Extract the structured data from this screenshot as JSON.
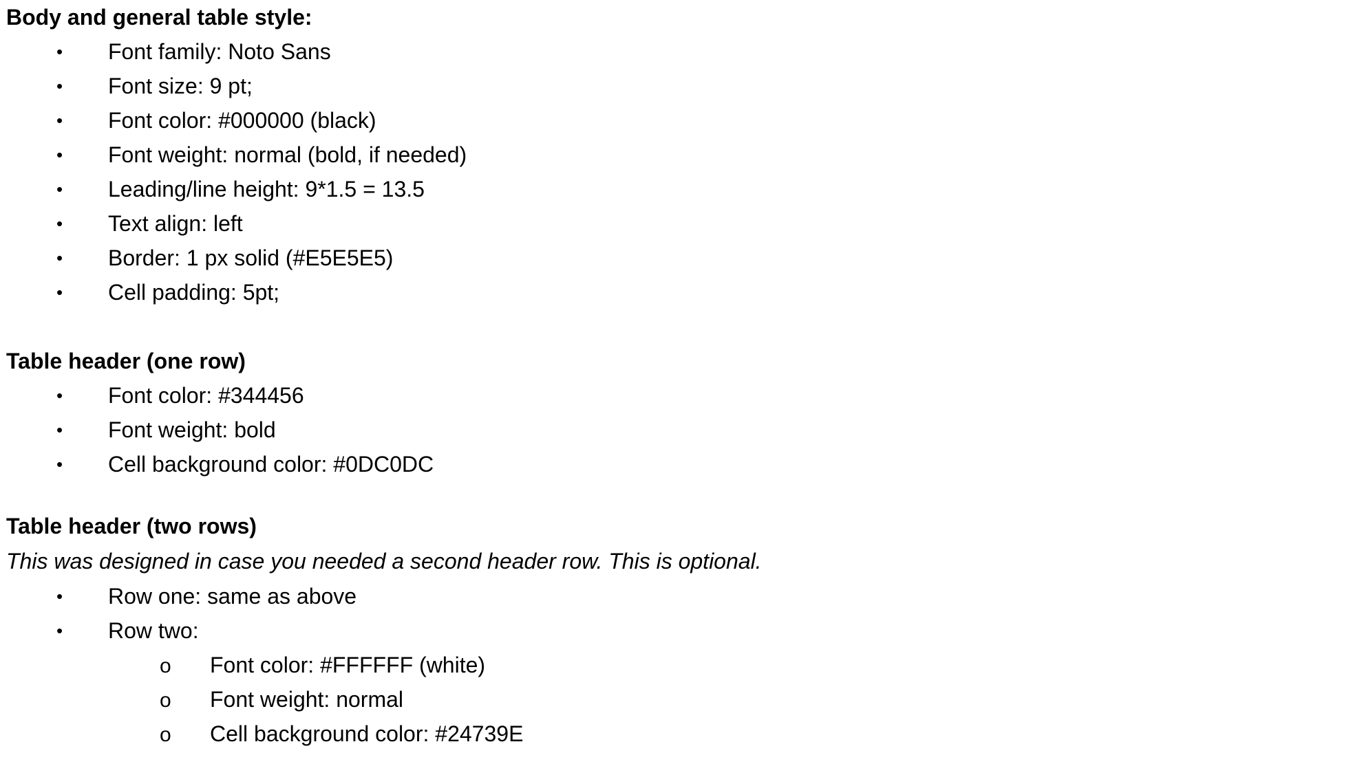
{
  "sections": {
    "body_style": {
      "heading": "Body and general table style:",
      "items": [
        "Font family: Noto Sans",
        "Font size: 9 pt;",
        "Font color: #000000 (black)",
        "Font weight: normal (bold, if needed)",
        "Leading/line height: 9*1.5 = 13.5",
        "Text align: left",
        "Border: 1 px solid (#E5E5E5)",
        "Cell padding: 5pt;"
      ]
    },
    "header_one_row": {
      "heading": "Table header (one row)",
      "items": [
        "Font color: #344456",
        "Font weight: bold",
        "Cell background color: #0DC0DC"
      ]
    },
    "header_two_rows": {
      "heading": "Table header (two rows)",
      "note": "This was designed in case you needed a second header row. This is optional.",
      "items": [
        "Row one: same as above",
        "Row two:"
      ],
      "sub_items": [
        "Font color: #FFFFFF (white)",
        "Font weight: normal",
        "Cell background color: #24739E"
      ]
    }
  },
  "markers": {
    "bullet": "•",
    "sub_bullet": "o"
  }
}
